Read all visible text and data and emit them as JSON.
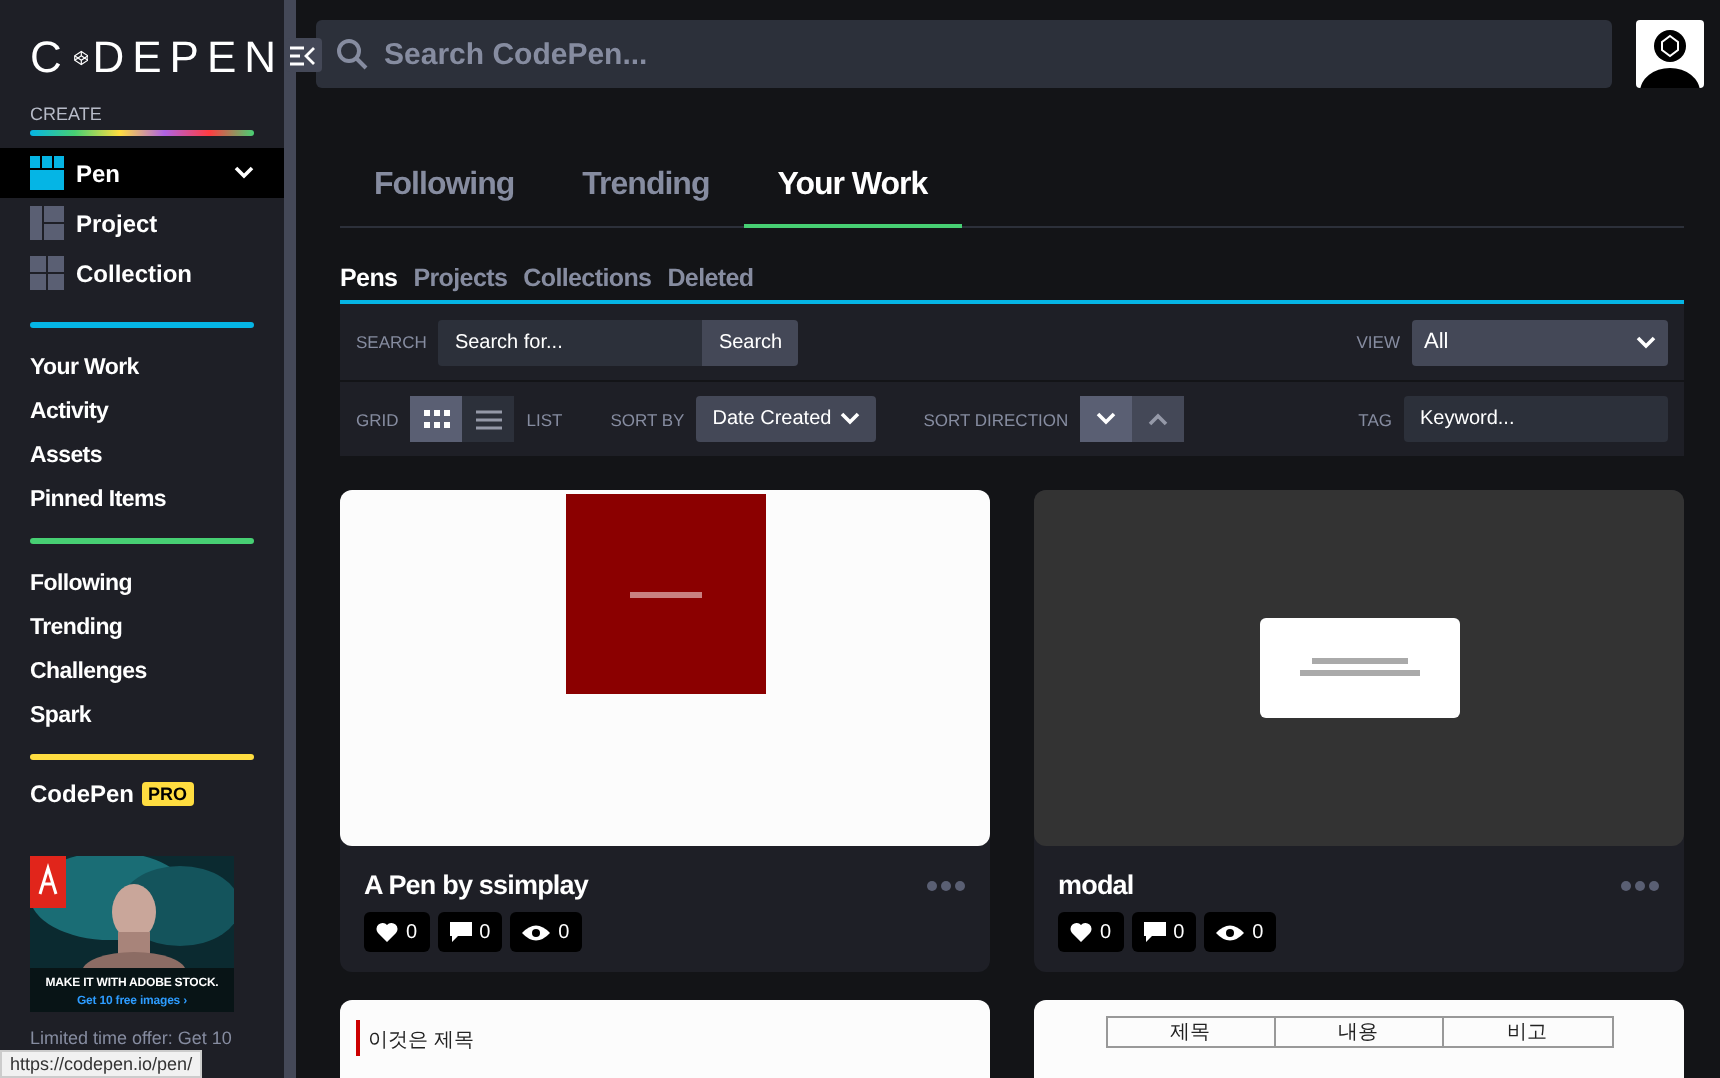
{
  "sidebar": {
    "logo": [
      "C",
      "DEPEN"
    ],
    "create_label": "CREATE",
    "create_items": [
      {
        "kind": "pen",
        "label": "Pen",
        "selected": true
      },
      {
        "kind": "project",
        "label": "Project",
        "selected": false
      },
      {
        "kind": "collection",
        "label": "Collection",
        "selected": false
      }
    ],
    "nav_groups": [
      {
        "color": "#05b5e5",
        "items": [
          "Your Work",
          "Activity",
          "Assets",
          "Pinned Items"
        ]
      },
      {
        "color": "#47cf73",
        "items": [
          "Following",
          "Trending",
          "Challenges",
          "Spark"
        ]
      },
      {
        "color": "#ffdd40"
      }
    ],
    "pro": {
      "label": "CodePen",
      "badge": "PRO"
    },
    "ad": {
      "headline": "MAKE IT WITH ADOBE STOCK.",
      "link": "Get 10 free images ›",
      "caption": "Limited time offer: Get 10"
    }
  },
  "search": {
    "placeholder": "Search CodePen..."
  },
  "tabs": [
    {
      "label": "Following",
      "selected": false
    },
    {
      "label": "Trending",
      "selected": false
    },
    {
      "label": "Your Work",
      "selected": true
    }
  ],
  "subtabs": [
    {
      "label": "Pens",
      "selected": true
    },
    {
      "label": "Projects",
      "selected": false
    },
    {
      "label": "Collections",
      "selected": false
    },
    {
      "label": "Deleted",
      "selected": false
    }
  ],
  "filters": {
    "search_label": "SEARCH",
    "search_placeholder": "Search for...",
    "search_button": "Search",
    "view_label": "VIEW",
    "view_value": "All",
    "grid_label": "GRID",
    "list_label": "LIST",
    "layout_options": [
      {
        "kind": "grid",
        "selected": true
      },
      {
        "kind": "list",
        "selected": false
      }
    ],
    "sort_label": "SORT BY",
    "sort_value": "Date Created",
    "direction_label": "SORT DIRECTION",
    "direction_options": [
      {
        "kind": "down",
        "selected": true
      },
      {
        "kind": "up",
        "selected": false
      }
    ],
    "tag_label": "TAG",
    "tag_placeholder": "Keyword..."
  },
  "cards": [
    {
      "kind": "box",
      "title": "A Pen by ssimplay",
      "likes": "0",
      "comments": "0",
      "views": "0"
    },
    {
      "kind": "modal",
      "title": "modal",
      "likes": "0",
      "comments": "0",
      "views": "0"
    },
    {
      "kind": "heading",
      "preview_text": [
        "이것은 제목"
      ]
    },
    {
      "kind": "table",
      "preview_text": [
        "제목",
        "내용",
        "비고"
      ]
    }
  ],
  "status_url": "https://codepen.io/pen/"
}
